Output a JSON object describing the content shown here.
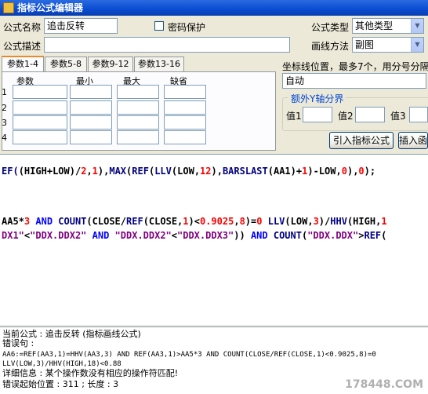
{
  "window": {
    "title": "指标公式编辑器"
  },
  "form": {
    "name_label": "公式名称",
    "name_value": "追击反转",
    "password_label": "密码保护",
    "password_checked": false,
    "type_label": "公式类型",
    "type_value": "其他类型",
    "desc_label": "公式描述",
    "desc_value": "",
    "draw_label": "画线方法",
    "draw_value": "副图"
  },
  "tabs": [
    {
      "label": "参数1-4",
      "active": true
    },
    {
      "label": "参数5-8",
      "active": false
    },
    {
      "label": "参数9-12",
      "active": false
    },
    {
      "label": "参数13-16",
      "active": false
    }
  ],
  "params": {
    "headers": [
      "参数",
      "最小",
      "最大",
      "缺省"
    ],
    "rows": [
      "1",
      "2",
      "3",
      "4"
    ]
  },
  "coord": {
    "label": "坐标线位置，最多7个，用分号分隔",
    "value": "自动",
    "extra_group_label": "额外Y轴分界",
    "value_labels": [
      "值1",
      "值2",
      "值3"
    ]
  },
  "buttons": {
    "import": "引入指标公式",
    "insert": "插入函"
  },
  "code": {
    "line1": [
      {
        "t": "EF(",
        "c": "fn"
      },
      {
        "t": "(",
        "c": "p"
      },
      {
        "t": "HIGH",
        "c": "v"
      },
      {
        "t": "+",
        "c": "p"
      },
      {
        "t": "LOW",
        "c": "v"
      },
      {
        "t": ")/",
        "c": "p"
      },
      {
        "t": "2",
        "c": "n"
      },
      {
        "t": ",",
        "c": "p"
      },
      {
        "t": "1",
        "c": "n"
      },
      {
        "t": "),",
        "c": "p"
      },
      {
        "t": "MAX",
        "c": "fn"
      },
      {
        "t": "(",
        "c": "p"
      },
      {
        "t": "REF",
        "c": "fn"
      },
      {
        "t": "(",
        "c": "p"
      },
      {
        "t": "LLV",
        "c": "fn"
      },
      {
        "t": "(",
        "c": "p"
      },
      {
        "t": "LOW",
        "c": "v"
      },
      {
        "t": ",",
        "c": "p"
      },
      {
        "t": "12",
        "c": "n"
      },
      {
        "t": "),",
        "c": "p"
      },
      {
        "t": "BARSLAST",
        "c": "fn"
      },
      {
        "t": "(",
        "c": "p"
      },
      {
        "t": "AA1",
        "c": "v"
      },
      {
        "t": ")+",
        "c": "p"
      },
      {
        "t": "1",
        "c": "n"
      },
      {
        "t": ")-",
        "c": "p"
      },
      {
        "t": "LOW",
        "c": "v"
      },
      {
        "t": ",",
        "c": "p"
      },
      {
        "t": "0",
        "c": "n"
      },
      {
        "t": "),",
        "c": "p"
      },
      {
        "t": "0",
        "c": "n"
      },
      {
        "t": ");",
        "c": "p"
      }
    ],
    "line2": [
      {
        "t": "AA5",
        "c": "v"
      },
      {
        "t": "*",
        "c": "p"
      },
      {
        "t": "3",
        "c": "n"
      },
      {
        "t": " AND ",
        "c": "kw"
      },
      {
        "t": "COUNT",
        "c": "fn"
      },
      {
        "t": "(",
        "c": "p"
      },
      {
        "t": "CLOSE",
        "c": "v"
      },
      {
        "t": "/",
        "c": "p"
      },
      {
        "t": "REF",
        "c": "fn"
      },
      {
        "t": "(",
        "c": "p"
      },
      {
        "t": "CLOSE",
        "c": "v"
      },
      {
        "t": ",",
        "c": "p"
      },
      {
        "t": "1",
        "c": "n"
      },
      {
        "t": ")<",
        "c": "p"
      },
      {
        "t": "0.9025",
        "c": "n"
      },
      {
        "t": ",",
        "c": "p"
      },
      {
        "t": "8",
        "c": "n"
      },
      {
        "t": ")=",
        "c": "p"
      },
      {
        "t": "0",
        "c": "n"
      },
      {
        "t": " ",
        "c": "p"
      },
      {
        "t": "LLV",
        "c": "fn"
      },
      {
        "t": "(",
        "c": "p"
      },
      {
        "t": "LOW",
        "c": "v"
      },
      {
        "t": ",",
        "c": "p"
      },
      {
        "t": "3",
        "c": "n"
      },
      {
        "t": ")/",
        "c": "p"
      },
      {
        "t": "HHV",
        "c": "fn"
      },
      {
        "t": "(",
        "c": "p"
      },
      {
        "t": "HIGH",
        "c": "v"
      },
      {
        "t": ",",
        "c": "p"
      },
      {
        "t": "1",
        "c": "n"
      }
    ],
    "line3": [
      {
        "t": "DX1\"",
        "c": "s"
      },
      {
        "t": "<",
        "c": "p"
      },
      {
        "t": "\"DDX.DDX2\"",
        "c": "s"
      },
      {
        "t": " AND ",
        "c": "kw"
      },
      {
        "t": "\"DDX.DDX2\"",
        "c": "s"
      },
      {
        "t": "<",
        "c": "p"
      },
      {
        "t": "\"DDX.DDX3\"",
        "c": "s"
      },
      {
        "t": ")) ",
        "c": "p"
      },
      {
        "t": "AND ",
        "c": "kw"
      },
      {
        "t": "COUNT",
        "c": "fn"
      },
      {
        "t": "(",
        "c": "p"
      },
      {
        "t": "\"DDX.DDX\"",
        "c": "s"
      },
      {
        "t": ">",
        "c": "p"
      },
      {
        "t": "REF",
        "c": "fn"
      },
      {
        "t": "(",
        "c": "p"
      }
    ]
  },
  "status": {
    "current": "当前公式 : 追击反转 (指标画线公式)",
    "error_label": "错误句 :",
    "error_text1": "AA6:=REF(AA3,1)=HHV(AA3,3) AND REF(AA3,1)>AA5*3 AND COUNT(CLOSE/REF(CLOSE,1)<0.9025,8)=0",
    "error_text2": "LLV(LOW,3)/HHV(HIGH,18)<0.88",
    "detail": "详细信息 : 某个操作数没有相应的操作符匹配!",
    "position": "错误起始位置 : 311 ; 长度 : 3"
  },
  "watermark": "178448.COM"
}
